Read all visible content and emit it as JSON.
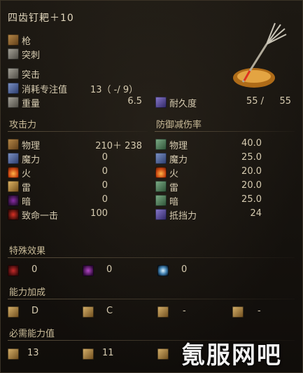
{
  "header": {
    "title": "四齿钉耙＋10"
  },
  "weapon": {
    "type_label": "枪",
    "attack_type_label": "突刺",
    "skill_label": "突击",
    "fp_cost": {
      "label": "消耗专注值",
      "value": "13（ -/ 9）"
    },
    "weight": {
      "label": "重量",
      "value": "6.5"
    },
    "durability": {
      "label": "耐久度",
      "current": "55 /",
      "max": "55"
    }
  },
  "attack": {
    "header": "攻击力",
    "rows": [
      {
        "label": "物理",
        "value": "210＋  238",
        "icon": "physical-icon"
      },
      {
        "label": "魔力",
        "value": "0",
        "icon": "magic-icon"
      },
      {
        "label": "火",
        "value": "0",
        "icon": "fire-icon"
      },
      {
        "label": "雷",
        "value": "0",
        "icon": "lightning-icon"
      },
      {
        "label": "暗",
        "value": "0",
        "icon": "dark-icon"
      },
      {
        "label": "致命一击",
        "value": "100",
        "icon": "critical-icon"
      }
    ]
  },
  "defense": {
    "header": "防御减伤率",
    "rows": [
      {
        "label": "物理",
        "value": "40.0",
        "icon": "physical-defense-icon"
      },
      {
        "label": "魔力",
        "value": "25.0",
        "icon": "magic-defense-icon"
      },
      {
        "label": "火",
        "value": "20.0",
        "icon": "fire-defense-icon"
      },
      {
        "label": "雷",
        "value": "20.0",
        "icon": "lightning-defense-icon"
      },
      {
        "label": "暗",
        "value": "25.0",
        "icon": "dark-defense-icon"
      },
      {
        "label": "抵挡力",
        "value": "24",
        "icon": "stability-icon"
      }
    ]
  },
  "effects": {
    "header": "特殊效果",
    "items": [
      {
        "value": "0",
        "icon": "bleed-icon"
      },
      {
        "value": "0",
        "icon": "poison-icon"
      },
      {
        "value": "0",
        "icon": "frost-icon"
      }
    ]
  },
  "scaling": {
    "header": "能力加成",
    "items": [
      {
        "value": "D",
        "icon": "strength-icon"
      },
      {
        "value": "C",
        "icon": "dexterity-icon"
      },
      {
        "value": "-",
        "icon": "intelligence-icon"
      },
      {
        "value": "-",
        "icon": "faith-icon"
      }
    ]
  },
  "requirements": {
    "header": "必需能力值",
    "items": [
      {
        "value": "13",
        "icon": "strength-req-icon"
      },
      {
        "value": "11",
        "icon": "dexterity-req-icon"
      },
      {
        "value": "",
        "icon": "intelligence-req-icon"
      }
    ]
  },
  "watermark": "氪服网吧"
}
